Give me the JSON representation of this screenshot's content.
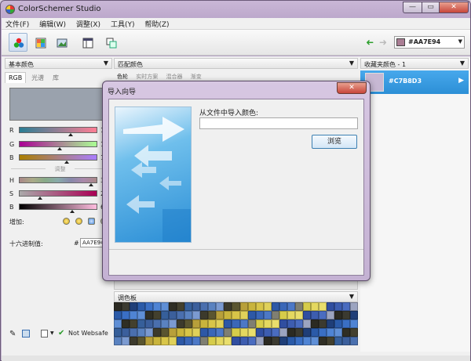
{
  "app": {
    "title": "ColorSchemer Studio"
  },
  "window_controls": {
    "minimize": "—",
    "maximize": "▭",
    "close": "✕"
  },
  "menu": [
    "文件(F)",
    "编辑(W)",
    "调整(X)",
    "工具(Y)",
    "帮助(Z)"
  ],
  "toolbar": {
    "current_color": "#AA7E94",
    "back_arrow": "➜",
    "forward_arrow": "➜"
  },
  "left_panel": {
    "header": "基本颜色",
    "tabs": [
      "RGB",
      "光谱",
      "库"
    ],
    "rgb": [
      {
        "label": "R",
        "value": "170"
      },
      {
        "label": "G",
        "value": "126"
      },
      {
        "label": "B",
        "value": "148"
      }
    ],
    "adjust_label": "调整",
    "hsb": [
      {
        "label": "H",
        "value": "330"
      },
      {
        "label": "S",
        "value": "26"
      },
      {
        "label": "B",
        "value": "67"
      }
    ],
    "add_label": "增加:",
    "hex_label": "十六进制值:",
    "hex_prefix": "#",
    "hex_value": "AA7E94",
    "websafe": "Not Websafe"
  },
  "middle_panel": {
    "header": "匹配颜色",
    "tabs": [
      "色轮",
      "实时方案",
      "混合器",
      "渐变"
    ],
    "palette_header": "调色板",
    "palette_colors": [
      "#2b2a22",
      "#3b3a30",
      "#1f3e78",
      "#2a5aa8",
      "#3a6fc4",
      "#4f84d4",
      "#5f8fd6",
      "#2f2e24",
      "#43402e",
      "#365f9a",
      "#3b5f9c",
      "#4a6fae",
      "#5a82c0",
      "#7b9ad0",
      "#3c3a2c",
      "#5a5530",
      "#b8a03a",
      "#c9b43c",
      "#d8c548",
      "#e0d15a",
      "#2d58a6",
      "#3a67b8",
      "#4c78c6",
      "#7f7f72",
      "#d6cc4a",
      "#e4d860",
      "#e9de6c",
      "#304ea0",
      "#3d5db0",
      "#4a6cc0",
      "#9ca4c0"
    ]
  },
  "right_panel": {
    "header": "收藏夹颜色",
    "count": "1",
    "item_value": "#C7B8D3",
    "item_swatch_color": "#C7B8D3",
    "arrow": "▶"
  },
  "dialog": {
    "title": "导入向导",
    "close": "✕",
    "label": "从文件中导入颜色:",
    "input_value": "",
    "browse": "浏览"
  }
}
